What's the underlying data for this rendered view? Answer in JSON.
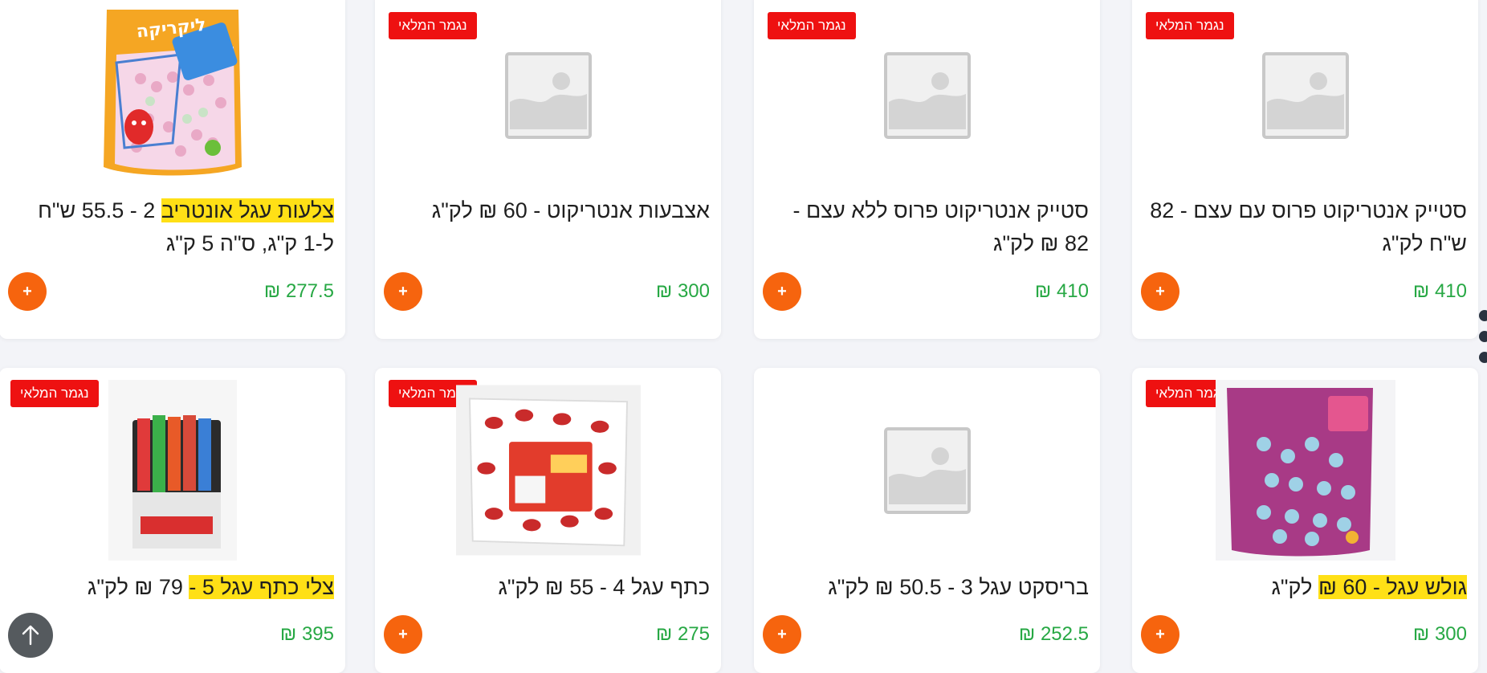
{
  "badge_text": "נגמר המלאי",
  "add_label": "+",
  "products": [
    {
      "title_plain": "",
      "title_highlight": "צלעות עגל אונטריב",
      "title_rest": " 2 - 55.5 ש\"ח ל-1 ק\"ג, ס\"ה 5 ק\"ג",
      "price": "277.5 ₪",
      "image": "candy-bag-strawberry",
      "out_of_stock": false
    },
    {
      "title_plain": "אצבעות אנטריקוט - 60 ₪ לק\"ג",
      "price": "300 ₪",
      "image": "placeholder",
      "out_of_stock": true
    },
    {
      "title_plain": "סטייק אנטריקוט פרוס ללא עצם - 82 ₪ לק\"ג",
      "price": "410 ₪",
      "image": "placeholder",
      "out_of_stock": true
    },
    {
      "title_plain": "סטייק אנטריקוט פרוס עם עצם - 82 ש\"ח לק\"ג",
      "price": "410 ₪",
      "image": "placeholder",
      "out_of_stock": true
    },
    {
      "title_highlight": "צלי כתף עגל 5 -",
      "title_rest": " 79 ₪ לק\"ג",
      "price": "395 ₪",
      "image": "candy-sticks-box",
      "out_of_stock": true
    },
    {
      "title_plain": "כתף עגל 4 - 55 ₪ לק\"ג",
      "price": "275 ₪",
      "image": "candy-bag-wrapped",
      "out_of_stock": true
    },
    {
      "title_plain": "בריסקט עגל 3 - 50.5 ₪ לק\"ג",
      "price": "252.5 ₪",
      "image": "placeholder",
      "out_of_stock": false
    },
    {
      "title_highlight": "גולש עגל - 60 ₪",
      "title_rest": " לק\"ג",
      "price": "300 ₪",
      "image": "candy-bag-purple",
      "out_of_stock": true
    }
  ],
  "colors": {
    "badge": "#ee1111",
    "price": "#27a844",
    "add_button": "#f6640e",
    "highlight": "#ffe016"
  }
}
